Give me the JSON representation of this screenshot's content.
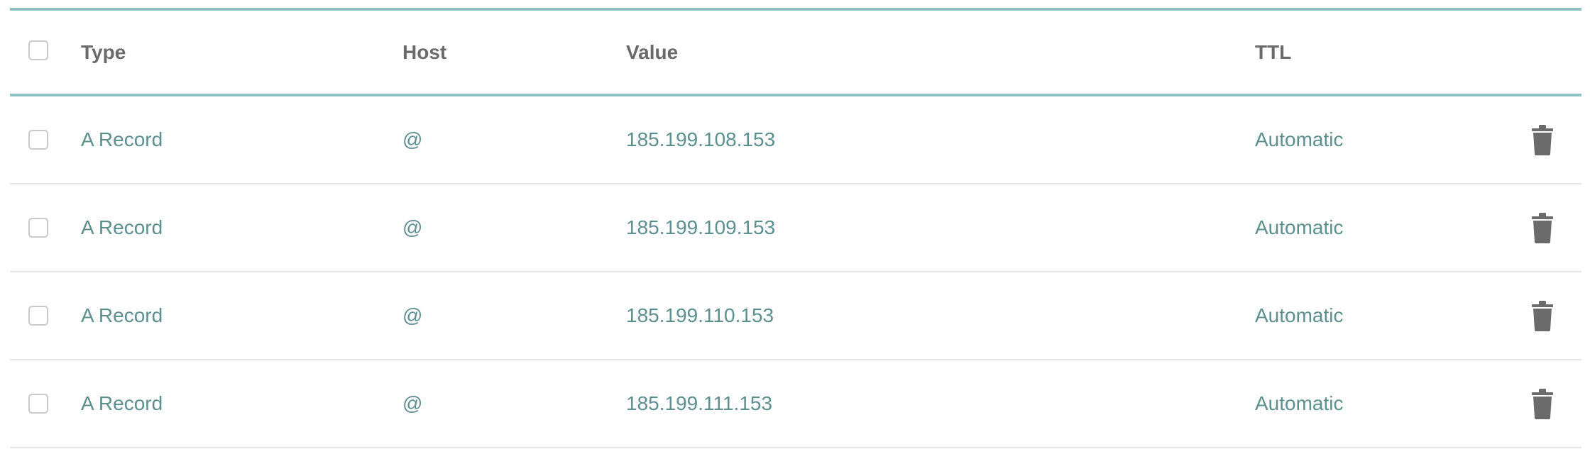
{
  "table": {
    "columns": {
      "type": "Type",
      "host": "Host",
      "value": "Value",
      "ttl": "TTL"
    },
    "rows": [
      {
        "type": "A Record",
        "host": "@",
        "value": "185.199.108.153",
        "ttl": "Automatic"
      },
      {
        "type": "A Record",
        "host": "@",
        "value": "185.199.109.153",
        "ttl": "Automatic"
      },
      {
        "type": "A Record",
        "host": "@",
        "value": "185.199.110.153",
        "ttl": "Automatic"
      },
      {
        "type": "A Record",
        "host": "@",
        "value": "185.199.111.153",
        "ttl": "Automatic"
      }
    ]
  },
  "colors": {
    "accent_rule": "#8fc3c3",
    "header_text": "#6a6a6a",
    "cell_text": "#5d8f8f",
    "trash_icon": "#6b6b6b"
  },
  "icons": {
    "row_action": "trash-icon",
    "select": "checkbox"
  }
}
